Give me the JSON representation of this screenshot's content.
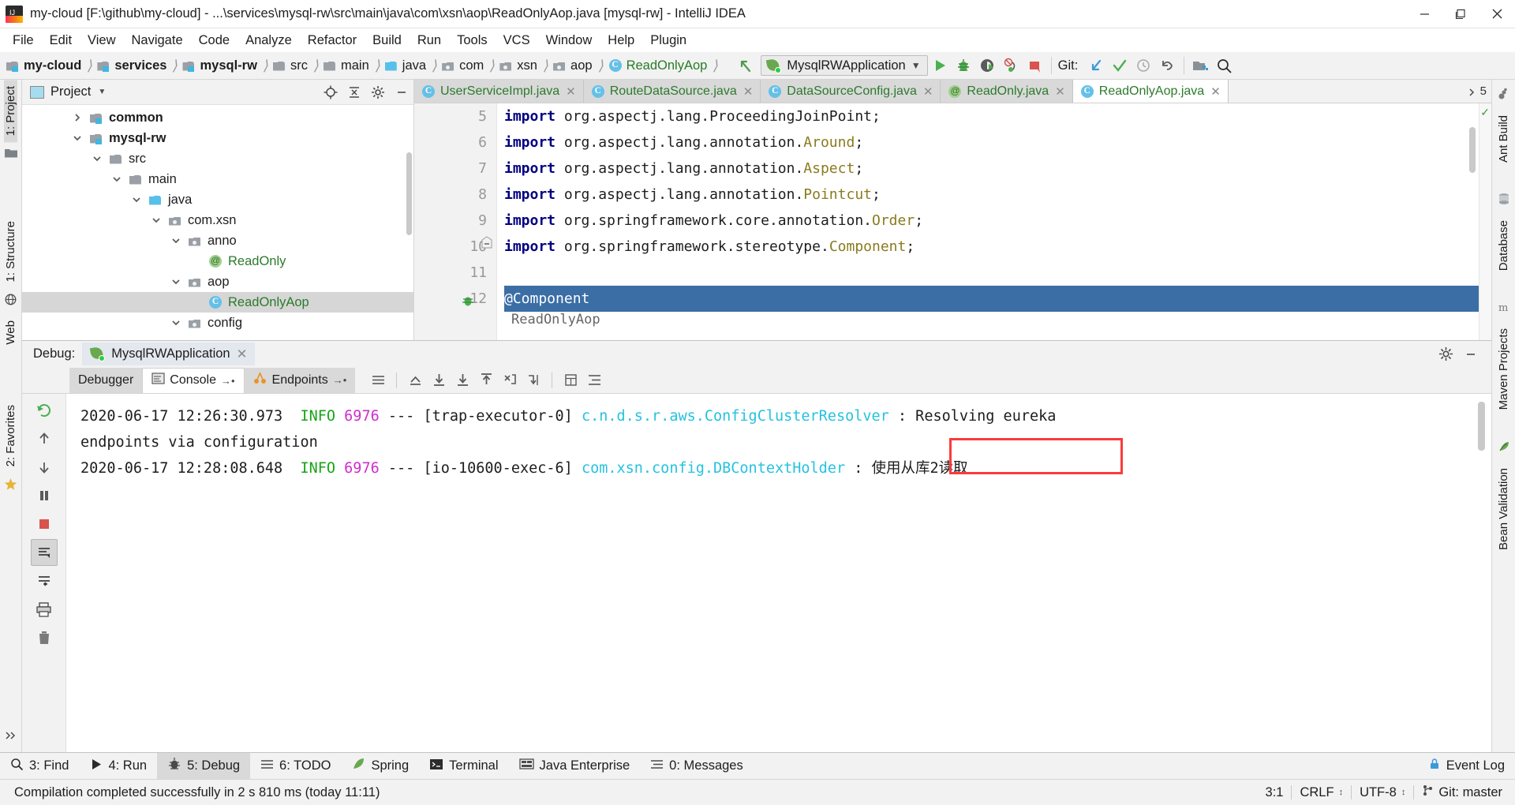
{
  "window": {
    "title": "my-cloud [F:\\github\\my-cloud] - ...\\services\\mysql-rw\\src\\main\\java\\com\\xsn\\aop\\ReadOnlyAop.java [mysql-rw] - IntelliJ IDEA",
    "minimize_label": "Minimize",
    "maximize_label": "Restore",
    "close_label": "Close"
  },
  "menu": [
    {
      "label": "File"
    },
    {
      "label": "Edit"
    },
    {
      "label": "View"
    },
    {
      "label": "Navigate"
    },
    {
      "label": "Code"
    },
    {
      "label": "Analyze"
    },
    {
      "label": "Refactor"
    },
    {
      "label": "Build"
    },
    {
      "label": "Run"
    },
    {
      "label": "Tools"
    },
    {
      "label": "VCS"
    },
    {
      "label": "Window"
    },
    {
      "label": "Help"
    },
    {
      "label": "Plugin"
    }
  ],
  "navbar": {
    "breadcrumbs": [
      {
        "label": "my-cloud",
        "icon": "module-folder-icon",
        "bold": true
      },
      {
        "label": "services",
        "icon": "module-folder-icon",
        "bold": true
      },
      {
        "label": "mysql-rw",
        "icon": "module-folder-icon",
        "bold": true
      },
      {
        "label": "src",
        "icon": "folder-icon",
        "bold": false
      },
      {
        "label": "main",
        "icon": "folder-icon",
        "bold": false
      },
      {
        "label": "java",
        "icon": "source-folder-icon",
        "bold": false
      },
      {
        "label": "com",
        "icon": "package-icon",
        "bold": false
      },
      {
        "label": "xsn",
        "icon": "package-icon",
        "bold": false
      },
      {
        "label": "aop",
        "icon": "package-icon",
        "bold": false
      },
      {
        "label": "ReadOnlyAop",
        "icon": "class-icon",
        "bold": false,
        "green": true
      }
    ],
    "run_configuration": "MysqlRWApplication",
    "git_label": "Git:",
    "buttons": {
      "back": "back-arrow-icon",
      "run": "run-icon",
      "debug": "debug-icon",
      "run_coverage": "run-with-coverage-icon",
      "profile": "profile-icon",
      "stop": "stop-icon",
      "update": "git-update-icon",
      "commit": "git-commit-icon",
      "history": "git-history-icon",
      "rollback": "git-rollback-icon",
      "settings": "project-settings-icon",
      "search": "search-everywhere-icon"
    }
  },
  "left_rail": {
    "project_label": "1: Project",
    "structure_label": "1: Structure",
    "favorites_label": "2: Favorites",
    "web_label": "Web"
  },
  "right_rail": {
    "items": [
      "Ant Build",
      "Database",
      "Maven Projects",
      "Bean Validation"
    ]
  },
  "project_panel": {
    "title": "Project",
    "tree": [
      {
        "label": "common",
        "indent": 1,
        "arrow": "right",
        "icon": "module-folder-icon",
        "bold": true,
        "selected": false
      },
      {
        "label": "mysql-rw",
        "indent": 1,
        "arrow": "down",
        "icon": "module-folder-icon",
        "bold": true,
        "selected": false
      },
      {
        "label": "src",
        "indent": 2,
        "arrow": "down",
        "icon": "folder-icon",
        "bold": false,
        "selected": false
      },
      {
        "label": "main",
        "indent": 3,
        "arrow": "down",
        "icon": "folder-icon",
        "bold": false,
        "selected": false
      },
      {
        "label": "java",
        "indent": 4,
        "arrow": "down",
        "icon": "source-folder-icon",
        "bold": false,
        "selected": false
      },
      {
        "label": "com.xsn",
        "indent": 5,
        "arrow": "down",
        "icon": "package-icon",
        "bold": false,
        "selected": false
      },
      {
        "label": "anno",
        "indent": 6,
        "arrow": "down",
        "icon": "package-icon",
        "bold": false,
        "selected": false
      },
      {
        "label": "ReadOnly",
        "indent": 7,
        "arrow": "none",
        "icon": "annotation-icon",
        "bold": false,
        "selected": false,
        "green": true
      },
      {
        "label": "aop",
        "indent": 6,
        "arrow": "down",
        "icon": "package-icon",
        "bold": false,
        "selected": false
      },
      {
        "label": "ReadOnlyAop",
        "indent": 7,
        "arrow": "none",
        "icon": "class-icon",
        "bold": false,
        "selected": true,
        "green": true
      },
      {
        "label": "config",
        "indent": 6,
        "arrow": "down",
        "icon": "package-icon",
        "bold": false,
        "selected": false
      }
    ]
  },
  "editor": {
    "tabs": [
      {
        "label": "UserServiceImpl.java",
        "icon": "class-icon",
        "active": false,
        "closable": true
      },
      {
        "label": "RouteDataSource.java",
        "icon": "class-icon",
        "active": false,
        "closable": true
      },
      {
        "label": "DataSourceConfig.java",
        "icon": "class-icon",
        "active": false,
        "closable": true
      },
      {
        "label": "ReadOnly.java",
        "icon": "annotation-icon",
        "active": false,
        "closable": true
      },
      {
        "label": "ReadOnlyAop.java",
        "icon": "class-icon",
        "active": true,
        "closable": true
      }
    ],
    "more_tabs_count": "5",
    "lines": [
      {
        "num": "5",
        "segments": [
          {
            "t": "import ",
            "c": "kw"
          },
          {
            "t": "org.aspectj.lang.ProceedingJoinPoint;",
            "c": "plain"
          }
        ]
      },
      {
        "num": "6",
        "segments": [
          {
            "t": "import ",
            "c": "kw"
          },
          {
            "t": "org.aspectj.lang.annotation.",
            "c": "plain"
          },
          {
            "t": "Around",
            "c": "ty"
          },
          {
            "t": ";",
            "c": "plain"
          }
        ]
      },
      {
        "num": "7",
        "segments": [
          {
            "t": "import ",
            "c": "kw"
          },
          {
            "t": "org.aspectj.lang.annotation.",
            "c": "plain"
          },
          {
            "t": "Aspect",
            "c": "ty"
          },
          {
            "t": ";",
            "c": "plain"
          }
        ]
      },
      {
        "num": "8",
        "segments": [
          {
            "t": "import ",
            "c": "kw"
          },
          {
            "t": "org.aspectj.lang.annotation.",
            "c": "plain"
          },
          {
            "t": "Pointcut",
            "c": "ty"
          },
          {
            "t": ";",
            "c": "plain"
          }
        ]
      },
      {
        "num": "9",
        "segments": [
          {
            "t": "import ",
            "c": "kw"
          },
          {
            "t": "org.springframework.core.annotation.",
            "c": "plain"
          },
          {
            "t": "Order",
            "c": "ty"
          },
          {
            "t": ";",
            "c": "plain"
          }
        ]
      },
      {
        "num": "10",
        "segments": [
          {
            "t": "import ",
            "c": "kw"
          },
          {
            "t": "org.springframework.stereotype.",
            "c": "plain"
          },
          {
            "t": "Component",
            "c": "ty"
          },
          {
            "t": ";",
            "c": "plain"
          }
        ]
      },
      {
        "num": "11",
        "segments": []
      },
      {
        "num": "12",
        "segments": [
          {
            "t": "@Component",
            "c": "plain"
          }
        ],
        "highlighted": true
      }
    ],
    "hint_text": "ReadOnlyAop"
  },
  "debug": {
    "label": "Debug:",
    "session_tab": "MysqlRWApplication",
    "tool_tabs": [
      {
        "label": "Debugger",
        "icon": "debugger-icon",
        "active": false,
        "pin": false
      },
      {
        "label": "Console",
        "icon": "console-icon",
        "active": true,
        "pin": true
      },
      {
        "label": "Endpoints",
        "icon": "endpoints-icon",
        "active": false,
        "pin": true
      }
    ],
    "toolbar_icons": [
      "scroll-to-end-icon",
      "trace-up-icon",
      "step-over-icon",
      "step-into-icon",
      "step-out-icon",
      "force-step-into-icon",
      "run-to-cursor-icon",
      "evaluate-icon",
      "soft-wrap-icon"
    ],
    "side_icons": [
      "rerun-icon",
      "up-icon",
      "down-icon",
      "pause-icon",
      "stop-icon",
      "scroll-end-icon",
      "soft-wrap-icon",
      "print-icon",
      "clear-all-icon"
    ],
    "console_lines": [
      {
        "segments": [
          {
            "t": "2020-06-17 12:26:30.973",
            "c": "c-ts"
          },
          {
            "t": "  ",
            "c": "c-msg"
          },
          {
            "t": "INFO",
            "c": "c-info"
          },
          {
            "t": " ",
            "c": "c-msg"
          },
          {
            "t": "6976",
            "c": "c-pid"
          },
          {
            "t": " --- ",
            "c": "c-dash"
          },
          {
            "t": "[trap-executor-0]",
            "c": "c-thread"
          },
          {
            "t": " ",
            "c": "c-msg"
          },
          {
            "t": "c.n.d.s.r.aws.ConfigClusterResolver",
            "c": "c-logger"
          },
          {
            "t": "      : Resolving eureka",
            "c": "c-msg"
          }
        ]
      },
      {
        "segments": [
          {
            "t": "  endpoints via configuration",
            "c": "c-msg"
          }
        ]
      },
      {
        "segments": [
          {
            "t": "2020-06-17 12:28:08.648",
            "c": "c-ts"
          },
          {
            "t": "  ",
            "c": "c-msg"
          },
          {
            "t": "INFO",
            "c": "c-info"
          },
          {
            "t": " ",
            "c": "c-msg"
          },
          {
            "t": "6976",
            "c": "c-pid"
          },
          {
            "t": " --- ",
            "c": "c-dash"
          },
          {
            "t": "[io-10600-exec-6]",
            "c": "c-thread"
          },
          {
            "t": " ",
            "c": "c-msg"
          },
          {
            "t": "com.xsn.config.DBContextHolder",
            "c": "c-logger"
          },
          {
            "t": "         : 使用从库2读取",
            "c": "c-msg"
          }
        ]
      }
    ],
    "highlight_color": "#fb3b3b"
  },
  "bottom_bar": {
    "items": [
      {
        "label": "3: Find",
        "icon": "search-icon",
        "selected": false
      },
      {
        "label": "4: Run",
        "icon": "run-icon",
        "selected": false
      },
      {
        "label": "5: Debug",
        "icon": "debug-icon",
        "selected": true
      },
      {
        "label": "6: TODO",
        "icon": "todo-icon",
        "selected": false
      },
      {
        "label": "Spring",
        "icon": "spring-icon",
        "selected": false
      },
      {
        "label": "Terminal",
        "icon": "terminal-icon",
        "selected": false
      },
      {
        "label": "Java Enterprise",
        "icon": "javaee-icon",
        "selected": false
      },
      {
        "label": "0: Messages",
        "icon": "messages-icon",
        "selected": false
      }
    ],
    "event_log": "Event Log"
  },
  "status_bar": {
    "message": "Compilation completed successfully in 2 s 810 ms (today 11:11)",
    "caret": "3:1",
    "line_separator": "CRLF",
    "encoding": "UTF-8",
    "branch": "Git: master"
  }
}
